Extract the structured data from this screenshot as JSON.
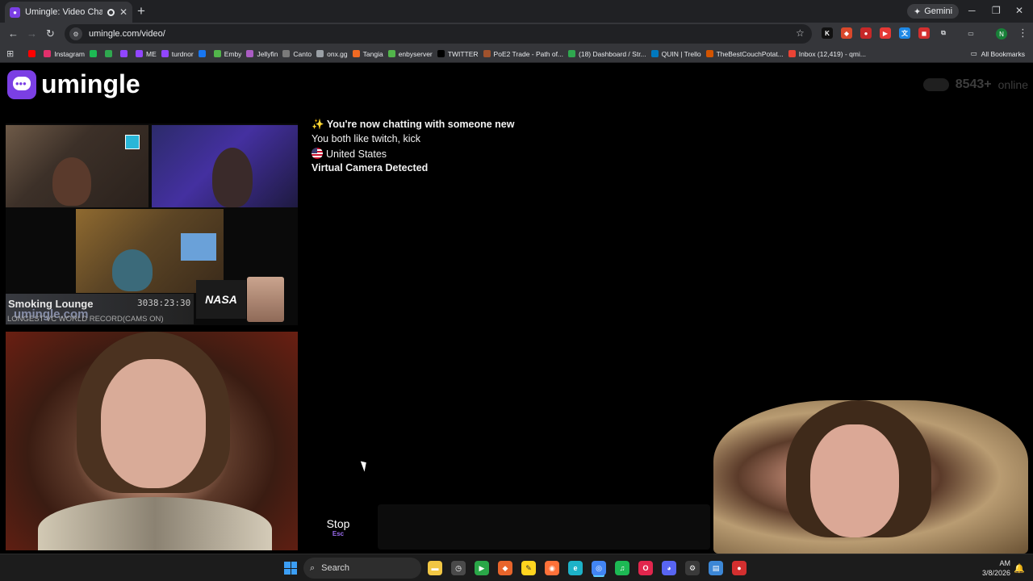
{
  "browser": {
    "tab_title": "Umingle: Video Chat with S",
    "new_tab": "+",
    "gemini_label": "Gemini",
    "url": "umingle.com/video/",
    "profile_initial": "N",
    "bookmarks": [
      {
        "label": "",
        "color": "#ff0000"
      },
      {
        "label": "Instagram",
        "color": "#e1306c"
      },
      {
        "label": "",
        "color": "#1db954"
      },
      {
        "label": "",
        "color": "#2fa84f"
      },
      {
        "label": "",
        "color": "#9146ff"
      },
      {
        "label": "ME",
        "color": "#9146ff"
      },
      {
        "label": "turdnor",
        "color": "#9146ff"
      },
      {
        "label": "",
        "color": "#1877f2"
      },
      {
        "label": "Emby",
        "color": "#52b54b"
      },
      {
        "label": "Jellyfin",
        "color": "#aa5cc3"
      },
      {
        "label": "Canto",
        "color": "#7a7a7a"
      },
      {
        "label": "onx.gg",
        "color": "#9aa0a6"
      },
      {
        "label": "Tangia",
        "color": "#f06a23"
      },
      {
        "label": "enbyserver",
        "color": "#52b54b"
      },
      {
        "label": "TWITTER",
        "color": "#000000"
      },
      {
        "label": "PoE2 Trade - Path of...",
        "color": "#a0522d"
      },
      {
        "label": "(18) Dashboard / Str...",
        "color": "#2fa84f"
      },
      {
        "label": "QUIN | Trello",
        "color": "#0079bf"
      },
      {
        "label": "TheBestCouchPotat...",
        "color": "#d35400"
      },
      {
        "label": "Inbox (12,419) - qmi...",
        "color": "#ea4335"
      }
    ],
    "all_bookmarks": "All Bookmarks"
  },
  "site": {
    "logo_text": "umingle",
    "online_count": "8543+",
    "online_label": "online"
  },
  "stranger_overlay": {
    "lounge_name": "Smoking Lounge",
    "lounge_logo": "umingle.com",
    "lounge_timer": "3038:23:30",
    "lounge_record": "LONGEST VC WORLD RECORD(CAMS ON)",
    "nasa_label": "NASA"
  },
  "chat": {
    "messages": [
      {
        "icon": "✨",
        "text": "You're now chatting with someone new"
      },
      {
        "text": "You both like twitch, kick"
      },
      {
        "text": "United States"
      },
      {
        "text": "Virtual Camera Detected"
      }
    ],
    "stop_label": "Stop",
    "stop_key": "Esc",
    "input_value": ""
  },
  "taskbar": {
    "search_label": "Search",
    "time": "AM",
    "date": "3/8/2026"
  }
}
